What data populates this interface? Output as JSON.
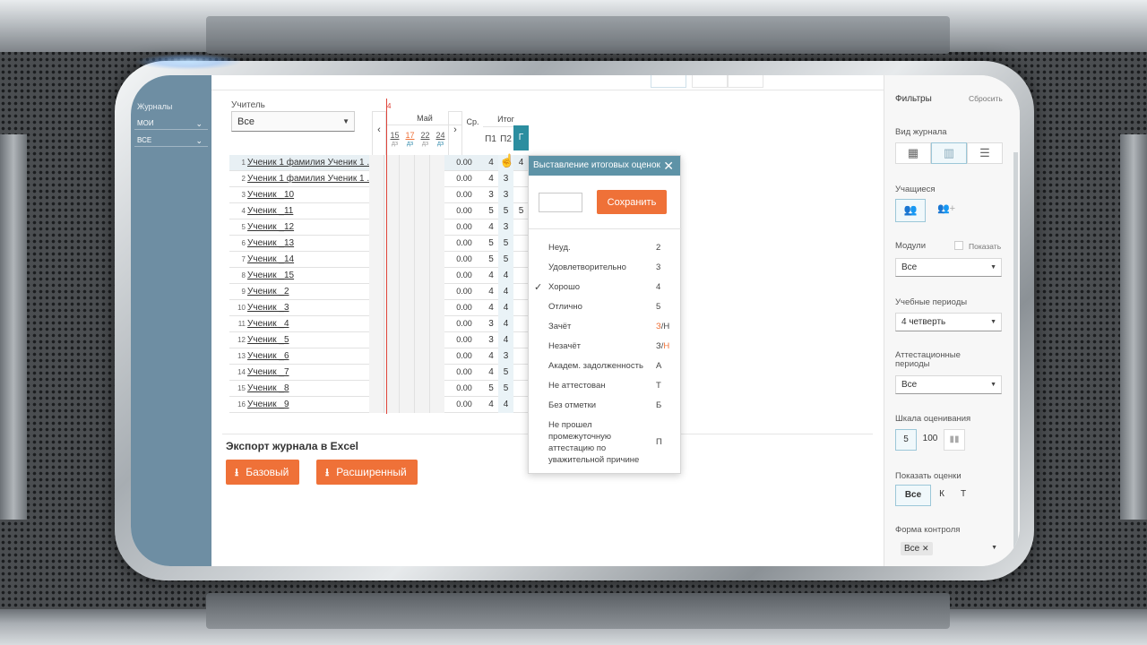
{
  "nav": {
    "label": "Журналы",
    "items": [
      {
        "label": "МОИ"
      },
      {
        "label": "ВСЕ"
      }
    ]
  },
  "teacher": {
    "label": "Учитель",
    "value": "Все"
  },
  "table": {
    "month": "Май",
    "month_marker": "4",
    "dates": [
      {
        "day": "15",
        "tag": "дз"
      },
      {
        "day": "17",
        "tag": "дз"
      },
      {
        "day": "22",
        "tag": "дз"
      },
      {
        "day": "24",
        "tag": "дз"
      }
    ],
    "avg_header": "Ср.",
    "total_header": "Итог",
    "total_cols": [
      "П1",
      "П2",
      "Г"
    ],
    "rows": [
      {
        "n": "1",
        "name": "Ученик 1 фамилия Ученик 1 ...",
        "avg": "0.00",
        "p1": "4",
        "p2": "",
        "g": "4"
      },
      {
        "n": "2",
        "name": "Ученик 1 фамилия Ученик 1 ...",
        "avg": "0.00",
        "p1": "4",
        "p2": "3",
        "g": ""
      },
      {
        "n": "3",
        "name": "Ученик _10",
        "avg": "0.00",
        "p1": "3",
        "p2": "3",
        "g": ""
      },
      {
        "n": "4",
        "name": "Ученик _11",
        "avg": "0.00",
        "p1": "5",
        "p2": "5",
        "g": "5"
      },
      {
        "n": "5",
        "name": "Ученик _12",
        "avg": "0.00",
        "p1": "4",
        "p2": "3",
        "g": ""
      },
      {
        "n": "6",
        "name": "Ученик _13",
        "avg": "0.00",
        "p1": "5",
        "p2": "5",
        "g": ""
      },
      {
        "n": "7",
        "name": "Ученик _14",
        "avg": "0.00",
        "p1": "5",
        "p2": "5",
        "g": ""
      },
      {
        "n": "8",
        "name": "Ученик _15",
        "avg": "0.00",
        "p1": "4",
        "p2": "4",
        "g": ""
      },
      {
        "n": "9",
        "name": "Ученик _2",
        "avg": "0.00",
        "p1": "4",
        "p2": "4",
        "g": ""
      },
      {
        "n": "10",
        "name": "Ученик _3",
        "avg": "0.00",
        "p1": "4",
        "p2": "4",
        "g": ""
      },
      {
        "n": "11",
        "name": "Ученик _4",
        "avg": "0.00",
        "p1": "3",
        "p2": "4",
        "g": ""
      },
      {
        "n": "12",
        "name": "Ученик _5",
        "avg": "0.00",
        "p1": "3",
        "p2": "4",
        "g": ""
      },
      {
        "n": "13",
        "name": "Ученик _6",
        "avg": "0.00",
        "p1": "4",
        "p2": "3",
        "g": ""
      },
      {
        "n": "14",
        "name": "Ученик _7",
        "avg": "0.00",
        "p1": "4",
        "p2": "5",
        "g": ""
      },
      {
        "n": "15",
        "name": "Ученик _8",
        "avg": "0.00",
        "p1": "5",
        "p2": "5",
        "g": ""
      },
      {
        "n": "16",
        "name": "Ученик _9",
        "avg": "0.00",
        "p1": "4",
        "p2": "4",
        "g": ""
      }
    ]
  },
  "export": {
    "title": "Экспорт журнала в Excel",
    "basic": "Базовый",
    "extended": "Расширенный"
  },
  "popup": {
    "title": "Выставление итоговых оценок",
    "save": "Сохранить",
    "options": [
      {
        "label": "Неуд.",
        "value": "2",
        "checked": false
      },
      {
        "label": "Удовлетворительно",
        "value": "3",
        "checked": false
      },
      {
        "label": "Хорошо",
        "value": "4",
        "checked": true
      },
      {
        "label": "Отлично",
        "value": "5",
        "checked": false
      },
      {
        "label": "Зачёт",
        "value_a": "З",
        "value_sep": "/",
        "value_b": "Н",
        "checked": false
      },
      {
        "label": "Незачёт",
        "value_a": "З",
        "value_sep": "/",
        "value_b": "Н",
        "checked": false
      },
      {
        "label": "Академ. задолженность",
        "value": "А",
        "checked": false
      },
      {
        "label": "Не аттестован",
        "value": "Т",
        "checked": false
      },
      {
        "label": "Без отметки",
        "value": "Б",
        "checked": false
      },
      {
        "label": "Не прошел промежуточную аттестацию по уважительной причине",
        "value": "П",
        "checked": false
      }
    ]
  },
  "filters": {
    "title": "Фильтры",
    "reset": "Сбросить",
    "view_label": "Вид журнала",
    "students_label": "Учащиеся",
    "modules_label": "Модули",
    "modules_show": "Показать",
    "modules_value": "Все",
    "periods_label": "Учебные периоды",
    "periods_value": "4 четверть",
    "attest_label": "Аттестационные периоды",
    "attest_value": "Все",
    "scale_label": "Шкала оценивания",
    "scale_5": "5",
    "scale_100": "100",
    "show_marks_label": "Показать оценки",
    "show_all": "Все",
    "show_k": "К",
    "show_t": "Т",
    "form_label": "Форма контроля",
    "form_value": "Все"
  },
  "colors": {
    "accent": "#ef7138",
    "popup_head": "#5e93a7",
    "nav": "#6e8ea3"
  }
}
